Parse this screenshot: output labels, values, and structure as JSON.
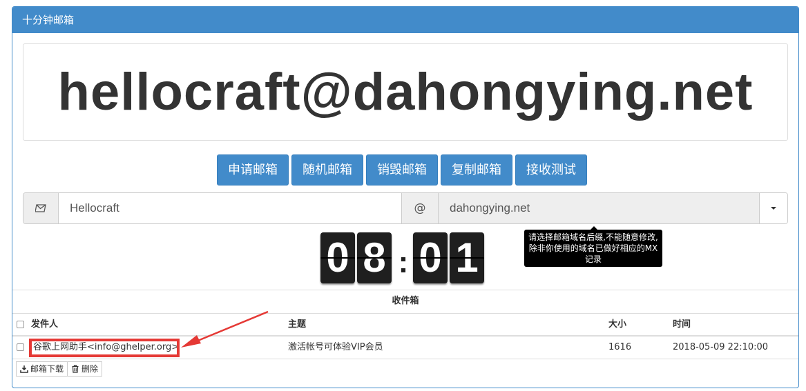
{
  "header": {
    "title": "十分钟邮箱"
  },
  "address": {
    "full": "hellocraft@dahongying.net"
  },
  "buttons": [
    "申请邮箱",
    "随机邮箱",
    "销毁邮箱",
    "复制邮箱",
    "接收测试"
  ],
  "form": {
    "username_value": "Hellocraft",
    "at_symbol": "@",
    "domain_value": "dahongying.net"
  },
  "timer": {
    "digits": [
      "0",
      "8",
      "0",
      "1"
    ],
    "separator": ":"
  },
  "tooltip": {
    "text": "请选择邮箱域名后缀,不能随意修改,除非你使用的域名已做好相应的MX记录"
  },
  "inbox": {
    "title": "收件箱",
    "columns": [
      "发件人",
      "主题",
      "大小",
      "时间"
    ],
    "rows": [
      {
        "sender": "谷歌上网助手<info@ghelper.org>",
        "subject": "激活帐号可体验VIP会员",
        "size": "1616",
        "time": "2018-05-09 22:10:00"
      }
    ]
  },
  "actions": {
    "download_label": "邮箱下载",
    "delete_label": "删除"
  },
  "colors": {
    "primary": "#428bca",
    "highlight": "#e53935"
  }
}
